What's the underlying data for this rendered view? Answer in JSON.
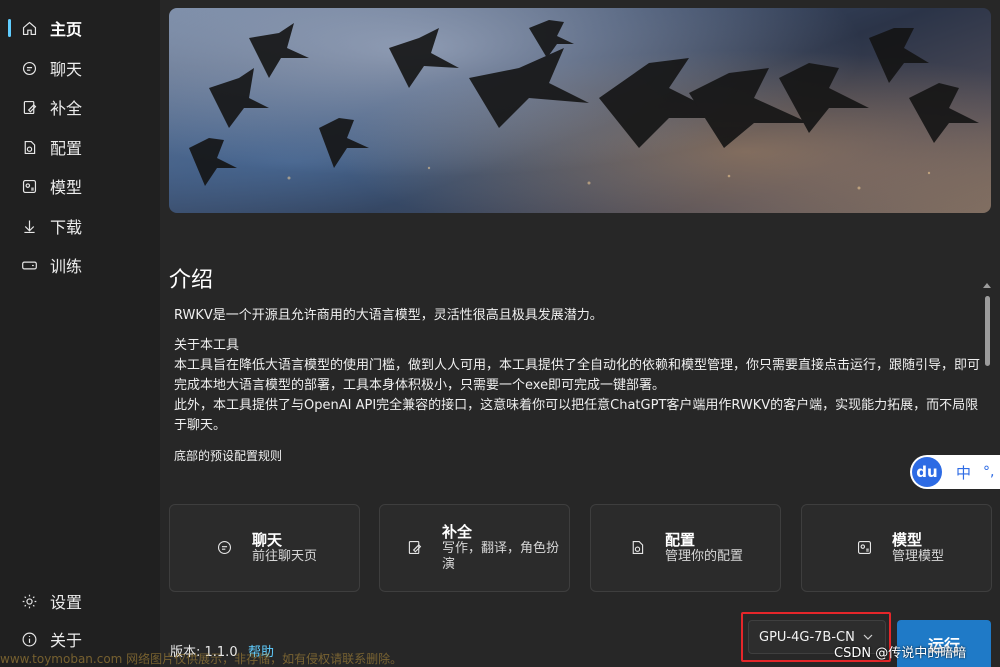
{
  "sidebar": {
    "items": [
      {
        "label": "主页",
        "icon": "home-icon",
        "active": true
      },
      {
        "label": "聊天",
        "icon": "chat-icon"
      },
      {
        "label": "补全",
        "icon": "completion-icon"
      },
      {
        "label": "配置",
        "icon": "config-icon"
      },
      {
        "label": "模型",
        "icon": "model-icon"
      },
      {
        "label": "下载",
        "icon": "download-icon"
      },
      {
        "label": "训练",
        "icon": "train-icon"
      }
    ],
    "bottom": [
      {
        "label": "设置",
        "icon": "gear-icon"
      },
      {
        "label": "关于",
        "icon": "info-icon"
      }
    ],
    "accent": "#60cdff"
  },
  "main": {
    "section_title": "介绍",
    "intro": {
      "p1": "RWKV是一个开源且允许商用的大语言模型，灵活性很高且极具发展潜力。",
      "about_heading": "关于本工具",
      "about_body": "本工具旨在降低大语言模型的使用门槛，做到人人可用，本工具提供了全自动化的依赖和模型管理，你只需要直接点击运行，跟随引导，即可完成本地大语言模型的部署，工具本身体积极小，只需要一个exe即可完成一键部署。",
      "about_body2": "此外，本工具提供了与OpenAI API完全兼容的接口，这意味着你可以把任意ChatGPT客户端用作RWKV的客户端，实现能力拓展，而不局限于聊天。",
      "footer_note": "底部的预设配置规则"
    },
    "cards": [
      {
        "title": "聊天",
        "desc": "前往聊天页",
        "icon": "chat-icon"
      },
      {
        "title": "补全",
        "desc": "写作，翻译，角色扮演",
        "icon": "completion-icon"
      },
      {
        "title": "配置",
        "desc": "管理你的配置",
        "icon": "config-icon"
      },
      {
        "title": "模型",
        "desc": "管理模型",
        "icon": "model-icon"
      }
    ]
  },
  "footer": {
    "version": "版本: 1.1.0",
    "help": "帮助",
    "model_select": "GPU-4G-7B-CN",
    "run_button": "运行"
  },
  "overlay": {
    "ime_logo": "du",
    "ime_lang": "中",
    "ime_dots": "°,",
    "watermark_right": "CSDN @传说中的暗暗",
    "watermark_left": "www.toymoban.com 网络图片仅供展示，非存储，如有侵权请联系删除。"
  }
}
